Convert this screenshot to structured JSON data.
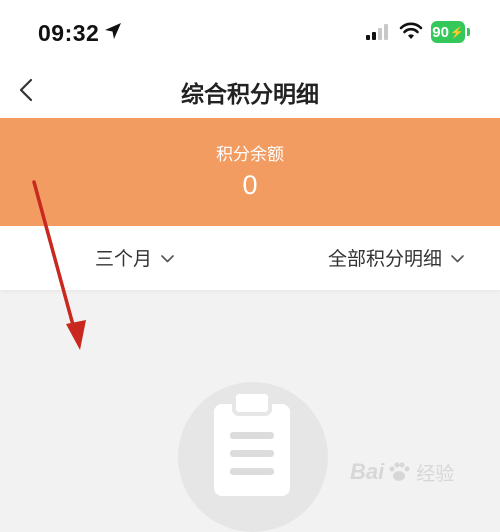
{
  "status_bar": {
    "time": "09:32",
    "battery": "90",
    "battery_color": "#34c759"
  },
  "nav": {
    "title": "综合积分明细",
    "back_icon": "chevron-left-icon"
  },
  "balance": {
    "label": "积分余额",
    "value": "0",
    "card_color": "#f29c61"
  },
  "filters": {
    "range_label": "三个月",
    "type_label": "全部积分明细"
  },
  "empty_state": {
    "icon": "clipboard-icon"
  },
  "annotation": {
    "arrow_color": "#c8281e"
  },
  "watermark": {
    "text_a": "Bai",
    "text_b": "经验"
  }
}
